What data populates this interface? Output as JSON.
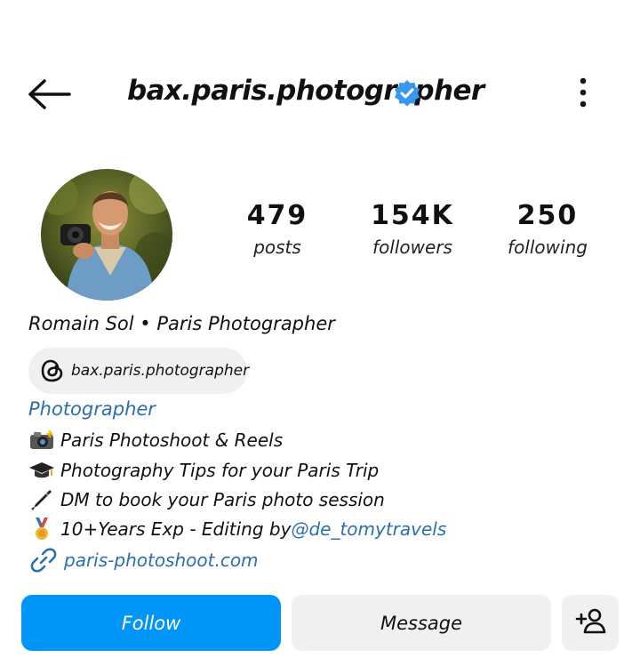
{
  "header": {
    "username": "bax.paris.photographer"
  },
  "stats": {
    "posts_count": "479",
    "posts_label": "posts",
    "followers_count": "154K",
    "followers_label": "followers",
    "following_count": "250",
    "following_label": "following"
  },
  "profile": {
    "full_name": "Romain Sol • Paris Photographer",
    "threads_handle": "bax.paris.photographer",
    "category": "Photographer",
    "bio_lines": [
      "Paris Photoshoot & Reels",
      "Photography Tips for your Paris Trip",
      "DM to book your Paris photo session"
    ],
    "bio_line4_text": "10+Years Exp - Editing by ",
    "bio_line4_mention": "@de_tomytravels",
    "website": "paris-photoshoot.com"
  },
  "actions": {
    "follow_label": "Follow",
    "message_label": "Message"
  },
  "colors": {
    "accent": "#0095f6",
    "link": "#2a6fb0",
    "verified": "#3897f0",
    "button_gray": "#eff0f2"
  },
  "icons": [
    "back-arrow-icon",
    "verified-badge-icon",
    "more-options-icon",
    "threads-icon",
    "camera-flash-emoji",
    "graduation-cap-emoji",
    "pen-emoji",
    "medal-emoji",
    "link-icon",
    "add-user-icon"
  ]
}
